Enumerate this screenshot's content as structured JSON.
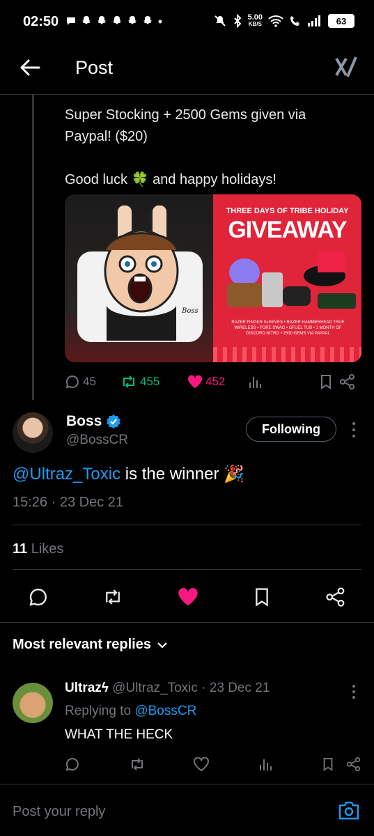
{
  "status_bar": {
    "time": "02:50",
    "speed_value": "5.00",
    "speed_unit": "KB/S",
    "battery": "63"
  },
  "header": {
    "title": "Post"
  },
  "parent_tweet": {
    "text": "Super Stocking + 2500 Gems given via\nPaypal! ($20)\n\nGood luck 🍀 and happy holidays!",
    "media": {
      "giveaway_small": "THREE DAYS OF TRIBE HOLIDAY",
      "giveaway_big": "GIVEAWAY",
      "prize_line": "RAZER FINGER SLEEVES • RAZER HAMMERHEAD TRUE WIRELESS • FORE SWAG • GFUEL TUB • 1 MONTH OF DISCORD NITRO • 2500 GEMS VIA PAYPAL",
      "signature": "Happy holidays from Boss"
    },
    "replies": "45",
    "reposts": "455",
    "likes": "452"
  },
  "main_tweet": {
    "name": "Boss",
    "handle": "@BossCR",
    "follow_label": "Following",
    "mention": "@Ultraz_Toxic",
    "text_rest": " is the winner 🎉",
    "time": "15:26",
    "date": "23 Dec 21",
    "likes_count": "11",
    "likes_label": "Likes"
  },
  "replies_section": {
    "heading": "Most relevant replies"
  },
  "reply": {
    "name": "Ultraz",
    "name_suffix": "ϟ",
    "handle": "@Ultraz_Toxic",
    "date": "23 Dec 21",
    "replying_prefix": "Replying to ",
    "replying_to": "@BossCR",
    "text": "WHAT THE HECK"
  },
  "composer": {
    "placeholder": "Post your reply"
  },
  "colors": {
    "accent": "#1d9bf0",
    "like": "#f91880",
    "repost": "#00ba7c",
    "muted": "#71767b",
    "background": "#000000"
  }
}
